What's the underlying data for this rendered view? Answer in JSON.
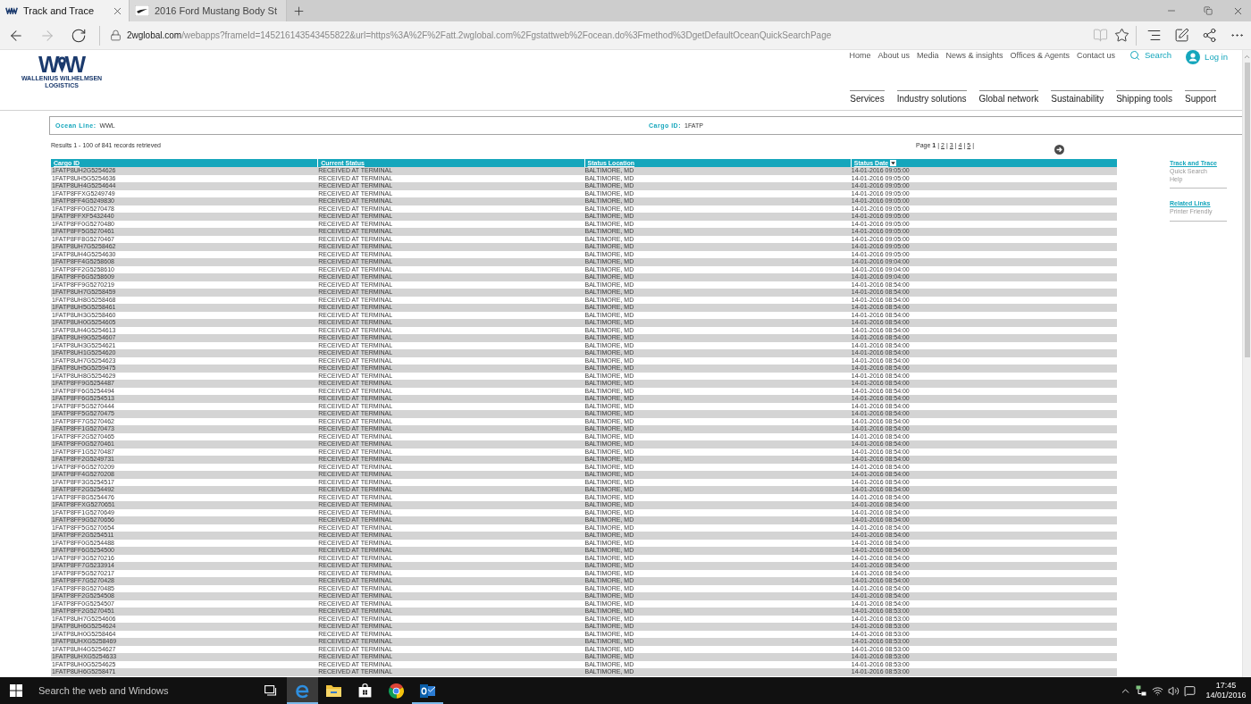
{
  "browser": {
    "tabs": [
      {
        "title": "Track and Trace",
        "kind": "zigzag",
        "selected": true
      },
      {
        "title": "2016 Ford Mustang Body St",
        "kind": "swoosh",
        "selected": false
      }
    ],
    "nav_buttons": [
      {
        "kind": "back",
        "disabled": false
      },
      {
        "kind": "forward",
        "disabled": true
      },
      {
        "kind": "refresh",
        "disabled": false
      }
    ],
    "address": {
      "domain": "2wglobal.com",
      "path": "/webapps?frameId=145216143543455822&url=https%3A%2F%2Fatt.2wglobal.com%2Fgstattweb%2Focean.do%3Fmethod%3DgetDefaultOceanQuickSearchPage"
    },
    "toolbar": [
      {
        "kind": "reading-view",
        "disabled": true
      },
      {
        "kind": "favorite",
        "disabled": false
      },
      {
        "kind": "hub",
        "disabled": false
      },
      {
        "kind": "note",
        "disabled": false
      },
      {
        "kind": "share",
        "disabled": false
      },
      {
        "kind": "more",
        "disabled": false
      }
    ]
  },
  "site_header": {
    "logo": {
      "mark": [
        "W",
        "W"
      ],
      "name": "WALLENIUS WILHELMSEN",
      "tagline": "LOGISTICS"
    },
    "top_links": [
      "Home",
      "About us",
      "Media",
      "News & insights",
      "Offices & Agents",
      "Contact us"
    ],
    "search": "Search",
    "login": "Log in",
    "main_nav": [
      "Services",
      "Industry solutions",
      "Global network",
      "Sustainability",
      "Shipping tools",
      "Support"
    ]
  },
  "criteria": [
    {
      "label": "Ocean Line:",
      "value": "WWL"
    },
    {
      "label": "Cargo ID:",
      "value": "1FATP"
    }
  ],
  "results": {
    "summary": "Results 1 - 100 of 841 records retrieved",
    "pager": {
      "label": "Page",
      "pages": [
        {
          "label": "1",
          "separator": "|",
          "selected": true
        },
        {
          "label": "2",
          "separator": "|",
          "selected": false
        },
        {
          "label": "3",
          "separator": "|",
          "selected": false
        },
        {
          "label": "4",
          "separator": "|",
          "selected": false
        },
        {
          "label": "5",
          "separator": "|",
          "selected": false
        }
      ]
    }
  },
  "table": {
    "columns": [
      {
        "label": "Cargo ID",
        "sorted": false
      },
      {
        "label": "Current Status",
        "sorted": false
      },
      {
        "label": "Status Location",
        "sorted": false
      },
      {
        "label": "Status Date",
        "sorted": true
      }
    ],
    "rows": [
      [
        "1FATP8UH2G5254626",
        "RECEIVED AT TERMINAL",
        "BALTIMORE, MD",
        "14-01-2016 09:05:00"
      ],
      [
        "1FATP8UH5G5254636",
        "RECEIVED AT TERMINAL",
        "BALTIMORE, MD",
        "14-01-2016 09:05:00"
      ],
      [
        "1FATP8UH4G5254644",
        "RECEIVED AT TERMINAL",
        "BALTIMORE, MD",
        "14-01-2016 09:05:00"
      ],
      [
        "1FATP8FFXG5249749",
        "RECEIVED AT TERMINAL",
        "BALTIMORE, MD",
        "14-01-2016 09:05:00"
      ],
      [
        "1FATP8FF4G5249830",
        "RECEIVED AT TERMINAL",
        "BALTIMORE, MD",
        "14-01-2016 09:05:00"
      ],
      [
        "1FATP8FF0G5270478",
        "RECEIVED AT TERMINAL",
        "BALTIMORE, MD",
        "14-01-2016 09:05:00"
      ],
      [
        "1FATP8FFXF5432440",
        "RECEIVED AT TERMINAL",
        "BALTIMORE, MD",
        "14-01-2016 09:05:00"
      ],
      [
        "1FATP8FF0G5270480",
        "RECEIVED AT TERMINAL",
        "BALTIMORE, MD",
        "14-01-2016 09:05:00"
      ],
      [
        "1FATP8FF5G5270461",
        "RECEIVED AT TERMINAL",
        "BALTIMORE, MD",
        "14-01-2016 09:05:00"
      ],
      [
        "1FATP8FF8G5270467",
        "RECEIVED AT TERMINAL",
        "BALTIMORE, MD",
        "14-01-2016 09:05:00"
      ],
      [
        "1FATP8UH7G5258462",
        "RECEIVED AT TERMINAL",
        "BALTIMORE, MD",
        "14-01-2016 09:05:00"
      ],
      [
        "1FATP8UH4G5254630",
        "RECEIVED AT TERMINAL",
        "BALTIMORE, MD",
        "14-01-2016 09:05:00"
      ],
      [
        "1FATP8FF4G5258608",
        "RECEIVED AT TERMINAL",
        "BALTIMORE, MD",
        "14-01-2016 09:04:00"
      ],
      [
        "1FATP8FF2G5258610",
        "RECEIVED AT TERMINAL",
        "BALTIMORE, MD",
        "14-01-2016 09:04:00"
      ],
      [
        "1FATP8FF6G5258609",
        "RECEIVED AT TERMINAL",
        "BALTIMORE, MD",
        "14-01-2016 09:04:00"
      ],
      [
        "1FATP8FF9G5270219",
        "RECEIVED AT TERMINAL",
        "BALTIMORE, MD",
        "14-01-2016 08:54:00"
      ],
      [
        "1FATP8UH7G5258459",
        "RECEIVED AT TERMINAL",
        "BALTIMORE, MD",
        "14-01-2016 08:54:00"
      ],
      [
        "1FATP8UH8G5258468",
        "RECEIVED AT TERMINAL",
        "BALTIMORE, MD",
        "14-01-2016 08:54:00"
      ],
      [
        "1FATP8UH5G5258461",
        "RECEIVED AT TERMINAL",
        "BALTIMORE, MD",
        "14-01-2016 08:54:00"
      ],
      [
        "1FATP8UH3G5258460",
        "RECEIVED AT TERMINAL",
        "BALTIMORE, MD",
        "14-01-2016 08:54:00"
      ],
      [
        "1FATP8UH0G5254605",
        "RECEIVED AT TERMINAL",
        "BALTIMORE, MD",
        "14-01-2016 08:54:00"
      ],
      [
        "1FATP8UH4G5254613",
        "RECEIVED AT TERMINAL",
        "BALTIMORE, MD",
        "14-01-2016 08:54:00"
      ],
      [
        "1FATP8UH9G5254607",
        "RECEIVED AT TERMINAL",
        "BALTIMORE, MD",
        "14-01-2016 08:54:00"
      ],
      [
        "1FATP8UH3G5254621",
        "RECEIVED AT TERMINAL",
        "BALTIMORE, MD",
        "14-01-2016 08:54:00"
      ],
      [
        "1FATP8UH1G5254620",
        "RECEIVED AT TERMINAL",
        "BALTIMORE, MD",
        "14-01-2016 08:54:00"
      ],
      [
        "1FATP8UH7G5254623",
        "RECEIVED AT TERMINAL",
        "BALTIMORE, MD",
        "14-01-2016 08:54:00"
      ],
      [
        "1FATP8UH5G5259475",
        "RECEIVED AT TERMINAL",
        "BALTIMORE, MD",
        "14-01-2016 08:54:00"
      ],
      [
        "1FATP8UH8G5254629",
        "RECEIVED AT TERMINAL",
        "BALTIMORE, MD",
        "14-01-2016 08:54:00"
      ],
      [
        "1FATP8FF9G5254487",
        "RECEIVED AT TERMINAL",
        "BALTIMORE, MD",
        "14-01-2016 08:54:00"
      ],
      [
        "1FATP8FF6G5254494",
        "RECEIVED AT TERMINAL",
        "BALTIMORE, MD",
        "14-01-2016 08:54:00"
      ],
      [
        "1FATP8FF6G5254513",
        "RECEIVED AT TERMINAL",
        "BALTIMORE, MD",
        "14-01-2016 08:54:00"
      ],
      [
        "1FATP8FF5G5270444",
        "RECEIVED AT TERMINAL",
        "BALTIMORE, MD",
        "14-01-2016 08:54:00"
      ],
      [
        "1FATP8FF5G5270475",
        "RECEIVED AT TERMINAL",
        "BALTIMORE, MD",
        "14-01-2016 08:54:00"
      ],
      [
        "1FATP8FF7G5270462",
        "RECEIVED AT TERMINAL",
        "BALTIMORE, MD",
        "14-01-2016 08:54:00"
      ],
      [
        "1FATP8FF1G5270473",
        "RECEIVED AT TERMINAL",
        "BALTIMORE, MD",
        "14-01-2016 08:54:00"
      ],
      [
        "1FATP8FF2G5270465",
        "RECEIVED AT TERMINAL",
        "BALTIMORE, MD",
        "14-01-2016 08:54:00"
      ],
      [
        "1FATP8FF0G5270461",
        "RECEIVED AT TERMINAL",
        "BALTIMORE, MD",
        "14-01-2016 08:54:00"
      ],
      [
        "1FATP8FF1G5270487",
        "RECEIVED AT TERMINAL",
        "BALTIMORE, MD",
        "14-01-2016 08:54:00"
      ],
      [
        "1FATP8FF2G5249731",
        "RECEIVED AT TERMINAL",
        "BALTIMORE, MD",
        "14-01-2016 08:54:00"
      ],
      [
        "1FATP8FF6G5270209",
        "RECEIVED AT TERMINAL",
        "BALTIMORE, MD",
        "14-01-2016 08:54:00"
      ],
      [
        "1FATP8FF4G5270208",
        "RECEIVED AT TERMINAL",
        "BALTIMORE, MD",
        "14-01-2016 08:54:00"
      ],
      [
        "1FATP8FF3G5254517",
        "RECEIVED AT TERMINAL",
        "BALTIMORE, MD",
        "14-01-2016 08:54:00"
      ],
      [
        "1FATP8FF2G5254492",
        "RECEIVED AT TERMINAL",
        "BALTIMORE, MD",
        "14-01-2016 08:54:00"
      ],
      [
        "1FATP8FF8G5254476",
        "RECEIVED AT TERMINAL",
        "BALTIMORE, MD",
        "14-01-2016 08:54:00"
      ],
      [
        "1FATP8FFXG5270651",
        "RECEIVED AT TERMINAL",
        "BALTIMORE, MD",
        "14-01-2016 08:54:00"
      ],
      [
        "1FATP8FF1G5270649",
        "RECEIVED AT TERMINAL",
        "BALTIMORE, MD",
        "14-01-2016 08:54:00"
      ],
      [
        "1FATP8FF9G5270656",
        "RECEIVED AT TERMINAL",
        "BALTIMORE, MD",
        "14-01-2016 08:54:00"
      ],
      [
        "1FATP8FF5G5270654",
        "RECEIVED AT TERMINAL",
        "BALTIMORE, MD",
        "14-01-2016 08:54:00"
      ],
      [
        "1FATP8FF2G5254511",
        "RECEIVED AT TERMINAL",
        "BALTIMORE, MD",
        "14-01-2016 08:54:00"
      ],
      [
        "1FATP8FF0G5254488",
        "RECEIVED AT TERMINAL",
        "BALTIMORE, MD",
        "14-01-2016 08:54:00"
      ],
      [
        "1FATP8FF6G5254500",
        "RECEIVED AT TERMINAL",
        "BALTIMORE, MD",
        "14-01-2016 08:54:00"
      ],
      [
        "1FATP8FF3G5270216",
        "RECEIVED AT TERMINAL",
        "BALTIMORE, MD",
        "14-01-2016 08:54:00"
      ],
      [
        "1FATP8FF7G5233914",
        "RECEIVED AT TERMINAL",
        "BALTIMORE, MD",
        "14-01-2016 08:54:00"
      ],
      [
        "1FATP8FF5G5270217",
        "RECEIVED AT TERMINAL",
        "BALTIMORE, MD",
        "14-01-2016 08:54:00"
      ],
      [
        "1FATP8FF7G5270428",
        "RECEIVED AT TERMINAL",
        "BALTIMORE, MD",
        "14-01-2016 08:54:00"
      ],
      [
        "1FATP8FF8G5270485",
        "RECEIVED AT TERMINAL",
        "BALTIMORE, MD",
        "14-01-2016 08:54:00"
      ],
      [
        "1FATP8FF2G5254508",
        "RECEIVED AT TERMINAL",
        "BALTIMORE, MD",
        "14-01-2016 08:54:00"
      ],
      [
        "1FATP8FF0G5254507",
        "RECEIVED AT TERMINAL",
        "BALTIMORE, MD",
        "14-01-2016 08:54:00"
      ],
      [
        "1FATP8FF2G5270451",
        "RECEIVED AT TERMINAL",
        "BALTIMORE, MD",
        "14-01-2016 08:53:00"
      ],
      [
        "1FATP8UH7G5254606",
        "RECEIVED AT TERMINAL",
        "BALTIMORE, MD",
        "14-01-2016 08:53:00"
      ],
      [
        "1FATP8UH6G5254624",
        "RECEIVED AT TERMINAL",
        "BALTIMORE, MD",
        "14-01-2016 08:53:00"
      ],
      [
        "1FATP8UH0G5258464",
        "RECEIVED AT TERMINAL",
        "BALTIMORE, MD",
        "14-01-2016 08:53:00"
      ],
      [
        "1FATP8UHXG5258469",
        "RECEIVED AT TERMINAL",
        "BALTIMORE, MD",
        "14-01-2016 08:53:00"
      ],
      [
        "1FATP8UH4G5254627",
        "RECEIVED AT TERMINAL",
        "BALTIMORE, MD",
        "14-01-2016 08:53:00"
      ],
      [
        "1FATP8UHXG5254633",
        "RECEIVED AT TERMINAL",
        "BALTIMORE, MD",
        "14-01-2016 08:53:00"
      ],
      [
        "1FATP8UH0G5254625",
        "RECEIVED AT TERMINAL",
        "BALTIMORE, MD",
        "14-01-2016 08:53:00"
      ],
      [
        "1FATP8UH6G5258471",
        "RECEIVED AT TERMINAL",
        "BALTIMORE, MD",
        "14-01-2016 08:53:00"
      ]
    ]
  },
  "sidebar": [
    {
      "title": "Track and Trace",
      "links": [
        "Quick Search",
        "Help"
      ]
    },
    {
      "title": "Related Links",
      "links": [
        "Printer Friendly"
      ]
    }
  ],
  "taskbar": {
    "search_placeholder": "Search the web and Windows",
    "apps": [
      {
        "kind": "task-view",
        "running": false,
        "selected": false
      },
      {
        "kind": "edge",
        "running": true,
        "selected": true
      },
      {
        "kind": "explorer",
        "running": false,
        "selected": false
      },
      {
        "kind": "store",
        "running": false,
        "selected": false
      },
      {
        "kind": "chrome",
        "running": false,
        "selected": false
      },
      {
        "kind": "outlook",
        "running": true,
        "selected": false
      }
    ],
    "time": "17:45",
    "date": "14/01/2016"
  }
}
